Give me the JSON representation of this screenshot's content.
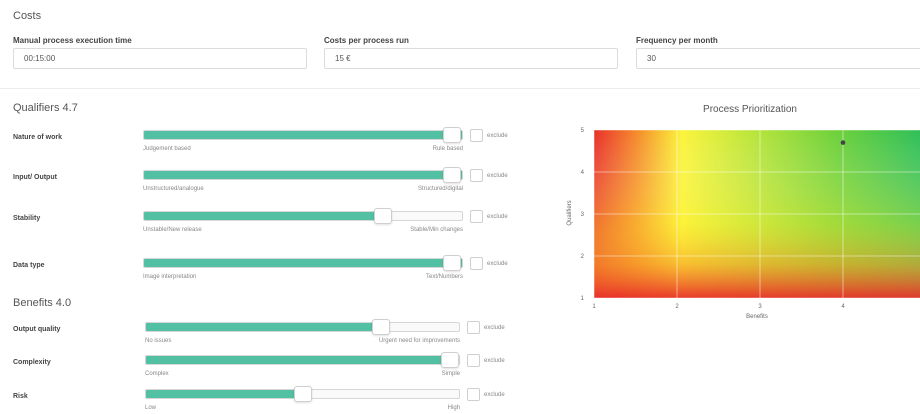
{
  "costs": {
    "title": "Costs",
    "fields": [
      {
        "label": "Manual process execution time",
        "value": "00:15:00"
      },
      {
        "label": "Costs per process run",
        "value": "15 €"
      },
      {
        "label": "Frequency per month",
        "value": "30"
      }
    ]
  },
  "qualifiers": {
    "title": "Qualifiers 4.7",
    "items": [
      {
        "label": "Nature of work",
        "min": "Judgement based",
        "max": "Rule based",
        "level": 1.0,
        "exclude": "exclude"
      },
      {
        "label": "Input/ Output",
        "min": "Unstructured/analogue",
        "max": "Structured/digital",
        "level": 1.0,
        "exclude": "exclude"
      },
      {
        "label": "Stability",
        "min": "Unstable/New release",
        "max": "Stable/Min changes",
        "level": 0.75,
        "exclude": "exclude"
      },
      {
        "label": "Data type",
        "min": "Image interpretation",
        "max": "Text/Numbers",
        "level": 1.0,
        "exclude": "exclude"
      }
    ]
  },
  "benefits": {
    "title": "Benefits 4.0",
    "items": [
      {
        "label": "Output quality",
        "min": "No issues",
        "max": "Urgent need for improvements",
        "level": 0.75,
        "exclude": "exclude"
      },
      {
        "label": "Complexity",
        "min": "Complex",
        "max": "Simple",
        "level": 1.0,
        "exclude": "exclude"
      },
      {
        "label": "Risk",
        "min": "Low",
        "max": "High",
        "level": 0.5,
        "exclude": "exclude"
      }
    ]
  },
  "chart_data": {
    "type": "scatter",
    "title": "Process Prioritization",
    "xlabel": "Benefits",
    "ylabel": "Qualifiers",
    "x_ticks": [
      "1",
      "2",
      "3",
      "4"
    ],
    "y_ticks": [
      "1",
      "2",
      "3",
      "4",
      "5"
    ],
    "xlim": [
      1,
      5
    ],
    "ylim": [
      1,
      5
    ],
    "grid": true,
    "background": "heatmap gradient red-yellow-green",
    "series": [
      {
        "x": [
          4.0
        ],
        "y": [
          4.7
        ]
      }
    ]
  }
}
